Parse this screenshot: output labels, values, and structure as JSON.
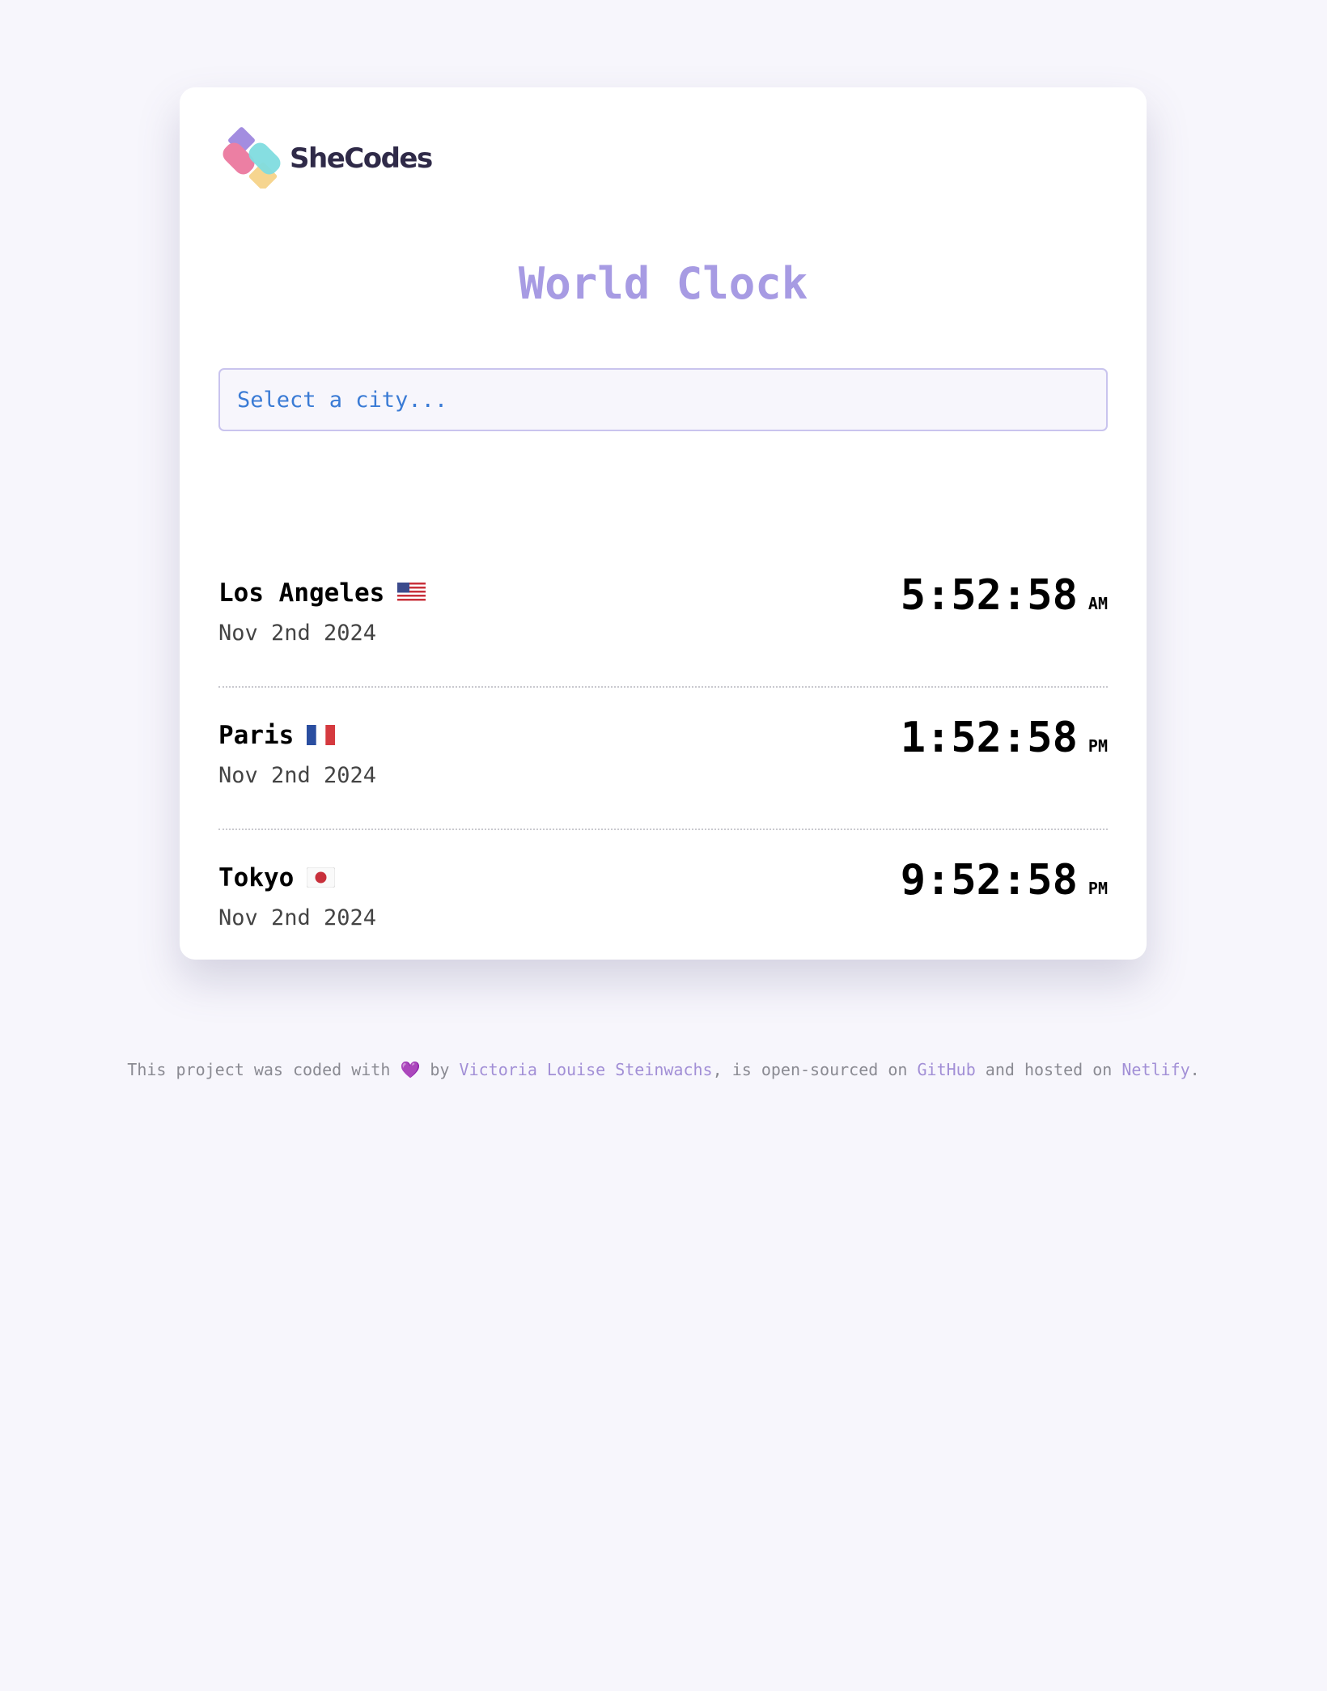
{
  "brand": {
    "name": "SheCodes",
    "icon": "shecodes-logo-icon",
    "colors": [
      "#a38de0",
      "#ec7fa3",
      "#7fdcdf",
      "#f6d58f"
    ]
  },
  "page_title": "World Clock",
  "city_select": {
    "placeholder": "Select a city...",
    "icon": "dropdown"
  },
  "cities": [
    {
      "name": "Los Angeles",
      "flag": "🇺🇸",
      "date": "Nov 2nd 2024",
      "time": "5:52:58",
      "period": "AM"
    },
    {
      "name": "Paris",
      "flag": "🇫🇷",
      "date": "Nov 2nd 2024",
      "time": "1:52:58",
      "period": "PM"
    },
    {
      "name": "Tokyo",
      "flag": "🇯🇵",
      "date": "Nov 2nd 2024",
      "time": "9:52:58",
      "period": "PM"
    }
  ],
  "footer": {
    "text_1": "This project was coded with",
    "heart": "💜",
    "text_2": "by",
    "author_link": "Victoria Louise Steinwachs",
    "text_3": ", is open-sourced on",
    "github_link": "GitHub",
    "text_4": "and hosted on",
    "netlify_link": "Netlify",
    "text_5": "."
  },
  "colors": {
    "accent": "#a79be3",
    "link": "#a28fd6",
    "select_text": "#3a7bd5",
    "background": "#f7f6fc"
  }
}
